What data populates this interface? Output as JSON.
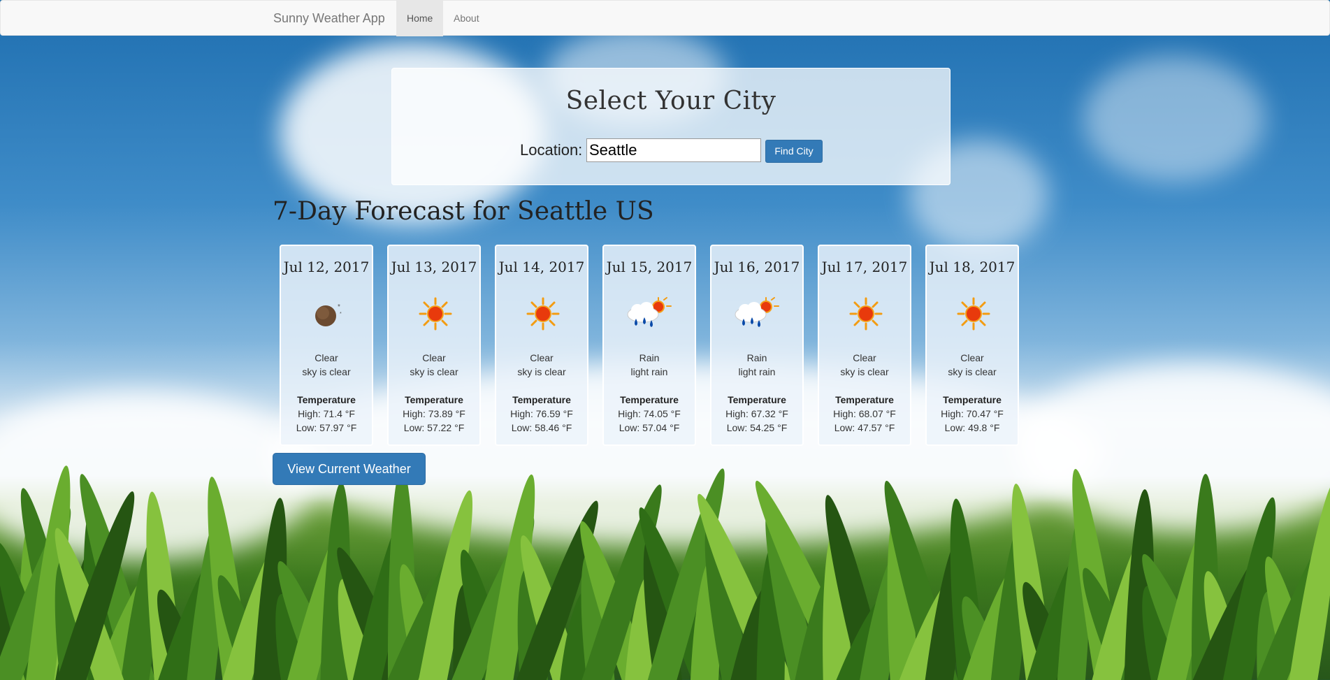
{
  "navbar": {
    "brand": "Sunny Weather App",
    "links": [
      {
        "label": "Home",
        "active": true
      },
      {
        "label": "About",
        "active": false
      }
    ]
  },
  "search": {
    "title": "Select Your City",
    "location_label": "Location:",
    "value": "Seattle",
    "button_label": "Find City"
  },
  "forecast": {
    "title": "7-Day Forecast for Seattle US",
    "temperature_label": "Temperature",
    "days": [
      {
        "date": "Jul 12, 2017",
        "icon": "moon-icon",
        "condition": "Clear",
        "description": "sky is clear",
        "high": "High: 71.4 °F",
        "low": "Low: 57.97 °F"
      },
      {
        "date": "Jul 13, 2017",
        "icon": "sun-icon",
        "condition": "Clear",
        "description": "sky is clear",
        "high": "High: 73.89 °F",
        "low": "Low: 57.22 °F"
      },
      {
        "date": "Jul 14, 2017",
        "icon": "sun-icon",
        "condition": "Clear",
        "description": "sky is clear",
        "high": "High: 76.59 °F",
        "low": "Low: 58.46 °F"
      },
      {
        "date": "Jul 15, 2017",
        "icon": "sun-rain-icon",
        "condition": "Rain",
        "description": "light rain",
        "high": "High: 74.05 °F",
        "low": "Low: 57.04 °F"
      },
      {
        "date": "Jul 16, 2017",
        "icon": "sun-rain-icon",
        "condition": "Rain",
        "description": "light rain",
        "high": "High: 67.32 °F",
        "low": "Low: 54.25 °F"
      },
      {
        "date": "Jul 17, 2017",
        "icon": "sun-icon",
        "condition": "Clear",
        "description": "sky is clear",
        "high": "High: 68.07 °F",
        "low": "Low: 47.57 °F"
      },
      {
        "date": "Jul 18, 2017",
        "icon": "sun-icon",
        "condition": "Clear",
        "description": "sky is clear",
        "high": "High: 70.47 °F",
        "low": "Low: 49.8 °F"
      }
    ]
  },
  "current_button": "View Current Weather",
  "colors": {
    "primary": "#337ab7",
    "navbar_bg": "#f8f8f8"
  }
}
